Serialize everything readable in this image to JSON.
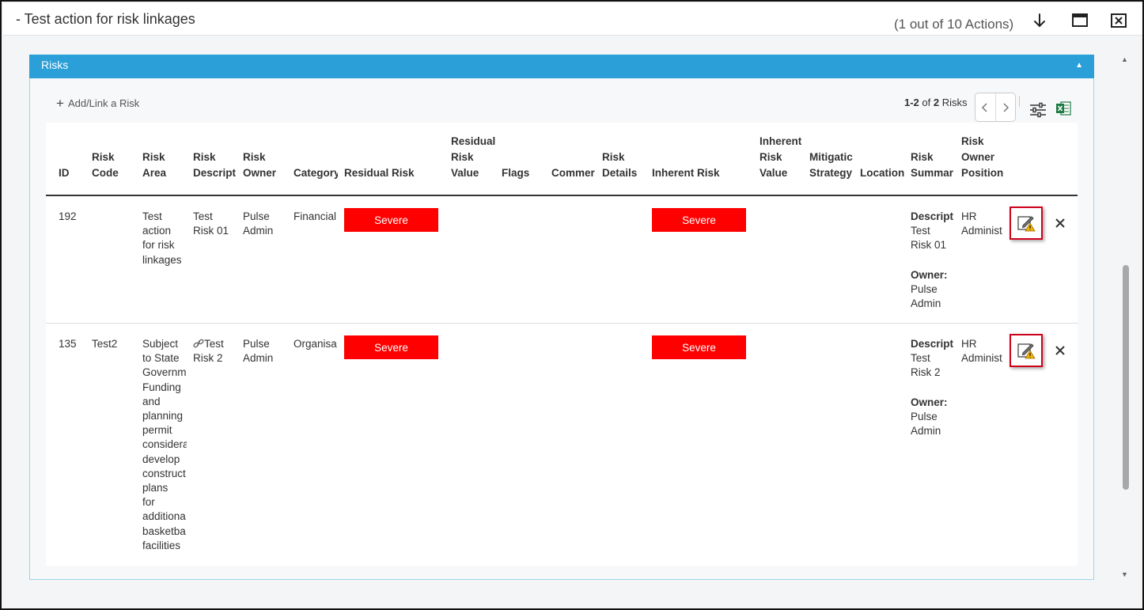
{
  "header": {
    "title": "- Test action for risk linkages",
    "counter": "(1 out of 10 Actions)"
  },
  "panel": {
    "title": "Risks",
    "add_link": "Add/Link a Risk",
    "pager": {
      "range": "1-2",
      "of": "of",
      "total": "2",
      "unit": "Risks"
    }
  },
  "columns": [
    [
      "ID"
    ],
    [
      "Risk",
      "Code"
    ],
    [
      "Risk",
      "Area"
    ],
    [
      "Risk",
      "Descript"
    ],
    [
      "Risk",
      "Owner"
    ],
    [
      "Category"
    ],
    [
      "Residual Risk"
    ],
    [
      "Residual",
      "Risk",
      "Value"
    ],
    [
      "Flags"
    ],
    [
      "Commer"
    ],
    [
      "Risk",
      "Details"
    ],
    [
      "Inherent Risk"
    ],
    [
      "Inherent",
      "Risk",
      "Value"
    ],
    [
      "Mitigatic",
      "Strategy"
    ],
    [
      "Location"
    ],
    [
      "Risk",
      "Summar"
    ],
    [
      "Risk",
      "Owner",
      "Position"
    ]
  ],
  "rows": [
    {
      "id": "192",
      "code": "",
      "area": [
        "Test",
        "action",
        "for risk",
        "linkages"
      ],
      "desc": [
        "Test",
        "Risk 01"
      ],
      "owner": [
        "Pulse",
        "Admin"
      ],
      "category": "Financial",
      "residual": "Severe",
      "inherent": "Severe",
      "summary_desc_label": "Descript",
      "summary_desc": [
        "Test",
        "Risk 01"
      ],
      "summary_owner_label": "Owner:",
      "summary_owner": [
        "Pulse",
        "Admin"
      ],
      "position": [
        "HR",
        "Administ"
      ]
    },
    {
      "id": "135",
      "code": "Test2",
      "area": [
        "Subject",
        "to State",
        "Governm",
        "Funding",
        "and",
        "planning",
        "permit",
        "considera",
        "develop",
        "construct",
        "plans",
        "for",
        "additiona",
        "basketba",
        "facilities"
      ],
      "desc": [
        "Test",
        "Risk 2"
      ],
      "owner": [
        "Pulse",
        "Admin"
      ],
      "category": "Organisa",
      "residual": "Severe",
      "inherent": "Severe",
      "summary_desc_label": "Descript",
      "summary_desc": [
        "Test",
        "Risk 2"
      ],
      "summary_owner_label": "Owner:",
      "summary_owner": [
        "Pulse",
        "Admin"
      ],
      "position": [
        "HR",
        "Administ"
      ]
    }
  ],
  "colors": {
    "panel_header": "#2a9fd8",
    "severe": "#ff0000",
    "edit_highlight": "#d0021b",
    "excel": "#1d7a44"
  },
  "icons": {
    "down": "arrow-down-icon",
    "maximize": "maximize-icon",
    "close": "close-icon",
    "add": "plus-icon",
    "prev": "chevron-left-icon",
    "next": "chevron-right-icon",
    "columns": "sliders-icon",
    "excel": "excel-icon",
    "edit": "edit-warning-icon",
    "remove": "close-icon",
    "link": "link-icon"
  }
}
